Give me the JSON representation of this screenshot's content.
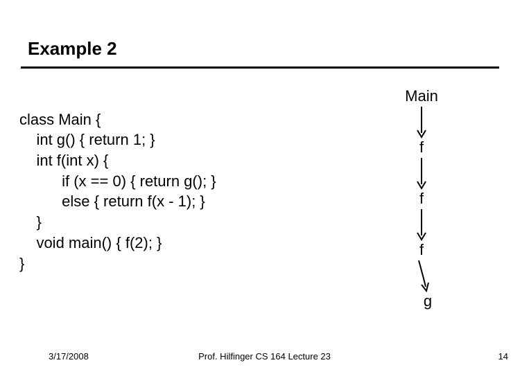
{
  "title": "Example 2",
  "code": {
    "l1": "class Main {",
    "l2": "    int g() { return 1; }",
    "l3": "    int f(int x) {",
    "l4": "          if (x == 0) { return g(); }",
    "l5": "          else { return f(x - 1); }",
    "l6": "    }",
    "l7": "    void main() { f(2); }",
    "l8": "}"
  },
  "diagram": {
    "n0": "Main",
    "n1": "f",
    "n2": "f",
    "n3": "f",
    "n4": "g"
  },
  "footer": {
    "date": "3/17/2008",
    "course": "Prof. Hilfinger  CS 164  Lecture 23",
    "page": "14"
  }
}
